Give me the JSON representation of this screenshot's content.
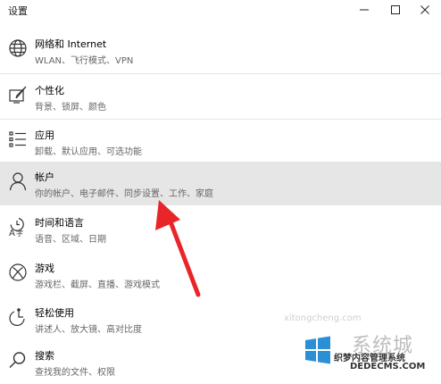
{
  "window": {
    "title": "设置",
    "controls": {
      "minimize": "minimize-icon",
      "maximize": "maximize-icon",
      "close": "close-icon"
    }
  },
  "settings_items": [
    {
      "label": "网络和 Internet",
      "description": "WLAN、飞行模式、VPN",
      "icon": "globe-icon"
    },
    {
      "label": "个性化",
      "description": "背景、锁屏、颜色",
      "icon": "personalization-icon"
    },
    {
      "label": "应用",
      "description": "卸载、默认应用、可选功能",
      "icon": "apps-list-icon"
    },
    {
      "label": "帐户",
      "description": "你的帐户、电子邮件、同步设置、工作、家庭",
      "icon": "person-icon",
      "selected": true
    },
    {
      "label": "时间和语言",
      "description": "语音、区域、日期",
      "icon": "time-language-icon"
    },
    {
      "label": "游戏",
      "description": "游戏栏、截屏、直播、游戏模式",
      "icon": "xbox-icon"
    },
    {
      "label": "轻松使用",
      "description": "讲述人、放大镜、高对比度",
      "icon": "ease-of-access-icon"
    },
    {
      "label": "搜索",
      "description": "查找我的文件、权限",
      "icon": "search-icon"
    }
  ],
  "colors": {
    "selected_background": "#e6e6e6",
    "annotation_arrow": "#e8262a"
  },
  "watermark": {
    "brand": "系统城",
    "cn_text": "织梦内容管理系统",
    "en_text": "DEDECMS.COM",
    "url_text": "xitongcheng.com"
  }
}
